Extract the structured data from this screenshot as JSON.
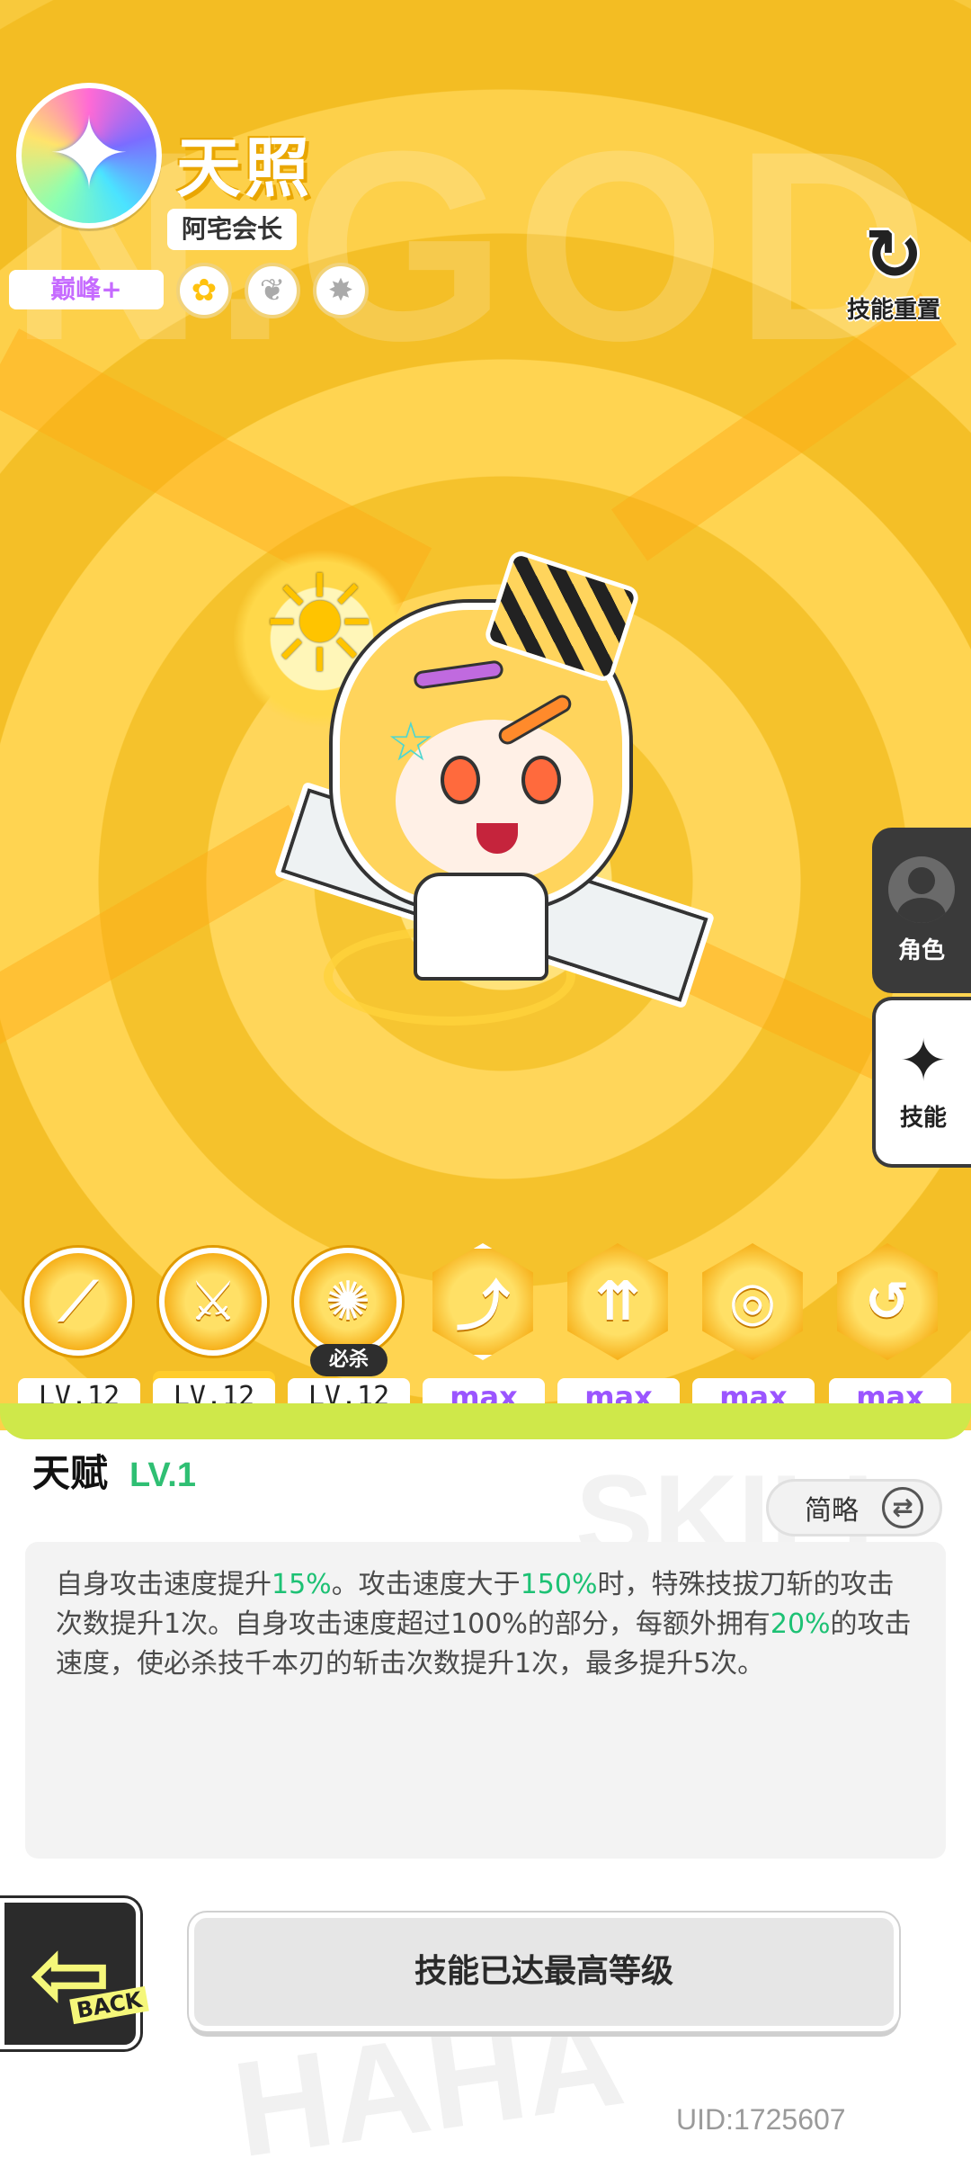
{
  "header": {
    "character_name": "天照",
    "character_title": "阿宅会长",
    "rank": "巅峰+",
    "emblem_icon": "star-emblem-icon",
    "attribute_icons": [
      "flower-icon",
      "feather-icon",
      "claw-icon"
    ],
    "reset_label": "技能重置"
  },
  "side_tabs": [
    {
      "label": "角色",
      "icon": "character-avatar-icon"
    },
    {
      "label": "技能",
      "icon": "sparkle-icon"
    }
  ],
  "skills": [
    {
      "level": "LV.12",
      "icon": "fan-icon",
      "shape": "circle"
    },
    {
      "level": "LV.12",
      "icon": "blade-icon",
      "shape": "circle"
    },
    {
      "level": "LV.12",
      "icon": "slash-icon",
      "shape": "circle",
      "tag": "必杀"
    },
    {
      "level": "max",
      "icon": "talent-icon",
      "shape": "hex",
      "selected": true
    },
    {
      "level": "max",
      "icon": "arrows-up-icon",
      "shape": "hex"
    },
    {
      "level": "max",
      "icon": "vortex-icon",
      "shape": "hex"
    },
    {
      "level": "max",
      "icon": "swirl-icon",
      "shape": "hex"
    }
  ],
  "talent": {
    "title": "天赋",
    "level": "LV.1",
    "toggle_label": "简略",
    "description_parts": [
      {
        "t": "自身攻击速度提升"
      },
      {
        "t": "15%",
        "hl": true
      },
      {
        "t": "。攻击速度大于"
      },
      {
        "t": "150%",
        "hl": true
      },
      {
        "t": "时，特殊技拔刀斩的攻击次数提升1次。自身攻击速度超过100%的部分，每额外拥有"
      },
      {
        "t": "20%",
        "hl": true
      },
      {
        "t": "的攻击速度，使必杀技千本刃的斩击次数提升1次，最多提升5次。"
      }
    ]
  },
  "footer": {
    "back_label": "BACK",
    "status_button": "技能已达最高等级",
    "uid": "UID:1725607"
  },
  "colors": {
    "stage_yellow": "#f5c22c",
    "highlight_green": "#1dc174",
    "max_purple": "#9b55ff"
  }
}
